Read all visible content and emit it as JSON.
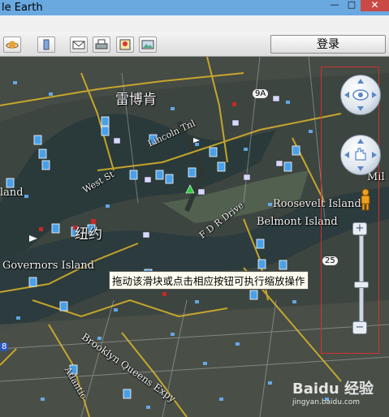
{
  "window": {
    "title": "le Earth",
    "minimize_glyph": "—",
    "maximize_glyph": "□",
    "close_glyph": "✕"
  },
  "toolbar": {
    "buttons": [
      "planet-icon",
      "sidebar-icon",
      "email-icon",
      "print-icon",
      "google-maps-icon",
      "image-icon"
    ],
    "login_label": "登录"
  },
  "map": {
    "labels": {
      "chongqing_bei": "雷博肯",
      "lincoln_tnl": "Lincoln Tnl",
      "west_st": "West St",
      "fdr_drive": "F D R Drive",
      "roosevelt_island": "Roosevelt Island",
      "belmont_island": "Belmont Island",
      "niuyue": "纽约",
      "governors_island": "Governors Island",
      "brooklyn_queens_expy": "Brooklyn Queens Expy",
      "land_left": "land",
      "mil_right": "Mil",
      "atlantic": "Atlantic",
      "route_9a": "9A",
      "route_25": "25",
      "route_278": "8"
    },
    "tooltip": "拖动该滑块或点击相应按钮可执行缩放操作"
  },
  "controls": {
    "zoom_in": "+",
    "zoom_out": "−",
    "zoom_level": 0.45
  },
  "watermark": {
    "text": "Baidu 经验",
    "subtext": "jingyan.baidu.com"
  }
}
